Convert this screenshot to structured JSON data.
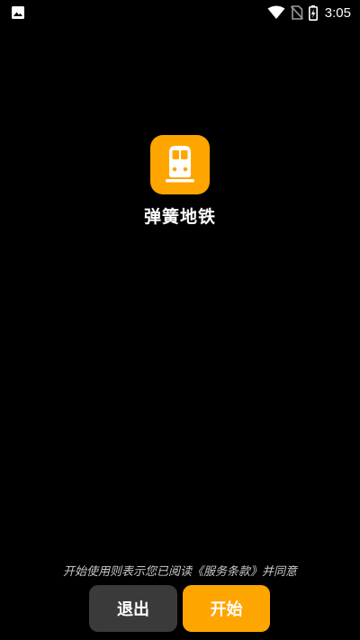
{
  "status_bar": {
    "time": "3:05",
    "icons": [
      "image-notification-icon",
      "wifi-icon",
      "no-sim-icon",
      "battery-charging-icon"
    ]
  },
  "app": {
    "name": "弹簧地铁",
    "icon": "subway-train-icon",
    "accent_color": "#ffa500"
  },
  "footer": {
    "agreement_text": "开始使用则表示您已阅读《服务条款》并同意",
    "exit_label": "退出",
    "start_label": "开始"
  },
  "colors": {
    "background": "#000000",
    "exit_button": "#3a3a3a",
    "start_button": "#ffa500"
  }
}
